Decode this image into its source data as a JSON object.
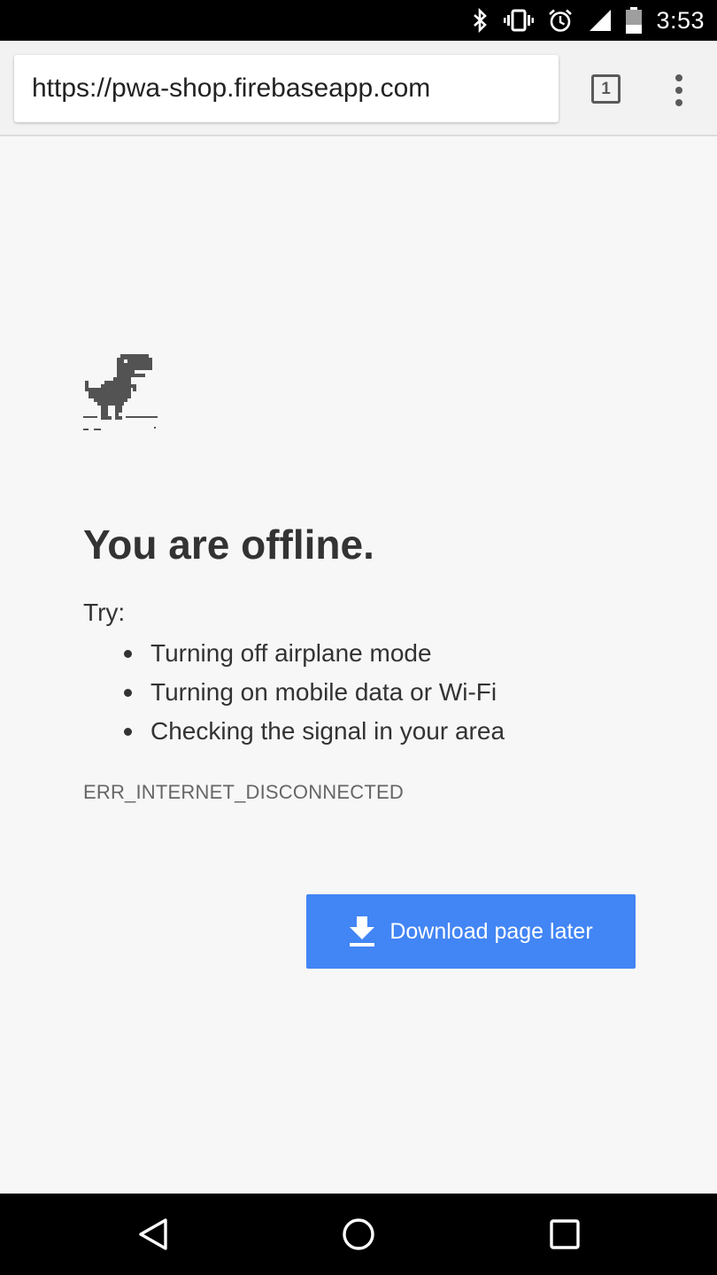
{
  "status_bar": {
    "time": "3:53",
    "icons": [
      "bluetooth-icon",
      "vibrate-icon",
      "alarm-icon",
      "signal-icon",
      "battery-icon"
    ]
  },
  "browser": {
    "url": "https://pwa-shop.firebaseapp.com",
    "tab_count": "1"
  },
  "page": {
    "title": "You are offline.",
    "try_label": "Try:",
    "suggestions": [
      "Turning off airplane mode",
      "Turning on mobile data or Wi-Fi",
      "Checking the signal in your area"
    ],
    "error_code": "ERR_INTERNET_DISCONNECTED",
    "download_button_label": "Download page later"
  },
  "navigation": {
    "buttons": [
      "back-icon",
      "home-icon",
      "recents-icon"
    ]
  },
  "colors": {
    "accent": "#4285f4",
    "background": "#f7f7f7",
    "text": "#333333"
  }
}
